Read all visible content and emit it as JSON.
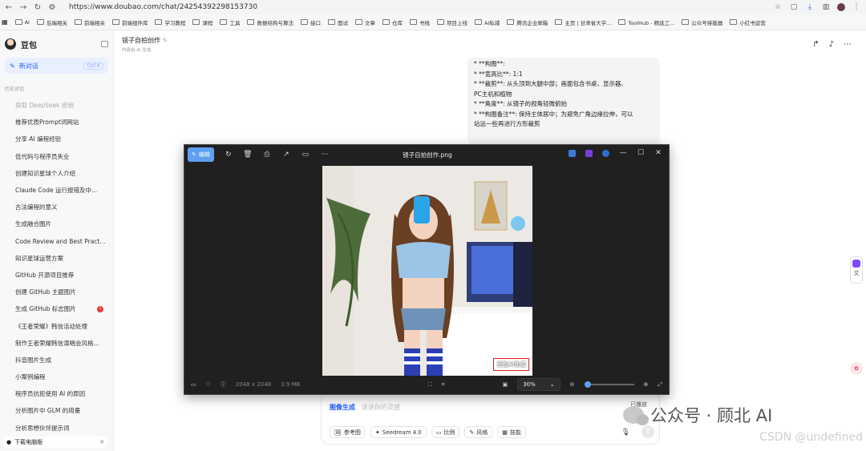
{
  "browser": {
    "url": "https://www.doubao.com/chat/24254392298153730",
    "bookmarks": [
      "AI",
      "后端相关",
      "前端相关",
      "前端组件库",
      "学习教程",
      "课程",
      "工具",
      "数据结构与算法",
      "接口",
      "面试",
      "文章",
      "仓库",
      "书栈",
      "项目上线",
      "AI私域",
      "腾讯企业邮箱",
      "主页 | 甘肃省大学...",
      "ToolHub - 精选工...",
      "公众号排版器",
      "小红书运营"
    ]
  },
  "sidebar": {
    "brand": "豆包",
    "new_chat": "新对话",
    "shortcut": "Ctrl K",
    "section": "历史对话",
    "history": [
      "获取 DeepSeek 密钥",
      "推荐优质Prompt词网站",
      "分享 AI 编程经验",
      "低代码与程序员失业",
      "创建知识星球个人介绍",
      "Claude Code 运行报错及中...",
      "古法编程的意义",
      "生成融合图片",
      "Code Review and Best Pract...",
      "知识星球运营方案",
      "GitHub 开源项目推荐",
      "创建 GitHub 主题图片",
      "生成 GitHub 标志图片",
      "《王者荣耀》韩信活动处理",
      "制作王者荣耀韩信演唱会风格...",
      "抖音图片生成",
      "小案例编程",
      "程序员抗拒使用 AI 的原因",
      "分析图片中 GLM 的用量",
      "分析思想伙伴提示词"
    ],
    "badge": "!",
    "download": "下载电脑版"
  },
  "chat": {
    "title": "镜子自拍创作",
    "subtitle": "内容由 AI 生成",
    "message_lines": [
      "* **构图**:",
      "* **宽高比**: 1:1",
      "* **裁剪**: 从头顶到大腿中部；画面包含书桌、显示器、",
      "PC主机和植物",
      "* **角度**: 从镜子的视角轻微俯拍",
      "* **构图备注**: 保持主体居中；为避免广角边缘拉伸，可以",
      "站远一些再进行方形裁剪"
    ]
  },
  "composer": {
    "mode": "图像生成",
    "placeholder": "说说你的灵感",
    "tools": [
      "参考图",
      "Seedream 4.0",
      "比例",
      "风格",
      "技能"
    ]
  },
  "viewer": {
    "edit_label": "编辑",
    "filename": "镜子自拍创作.png",
    "dimensions": "2048 x 2048",
    "filesize": "3.9 MB",
    "zoom": "30%",
    "zoom_fraction": 0.0,
    "watermark": "豆包AI生成"
  },
  "overlay": {
    "wechat": "公众号 · 顾北 AI",
    "csdn": "CSDN @undefined",
    "tiny": "已播放"
  }
}
